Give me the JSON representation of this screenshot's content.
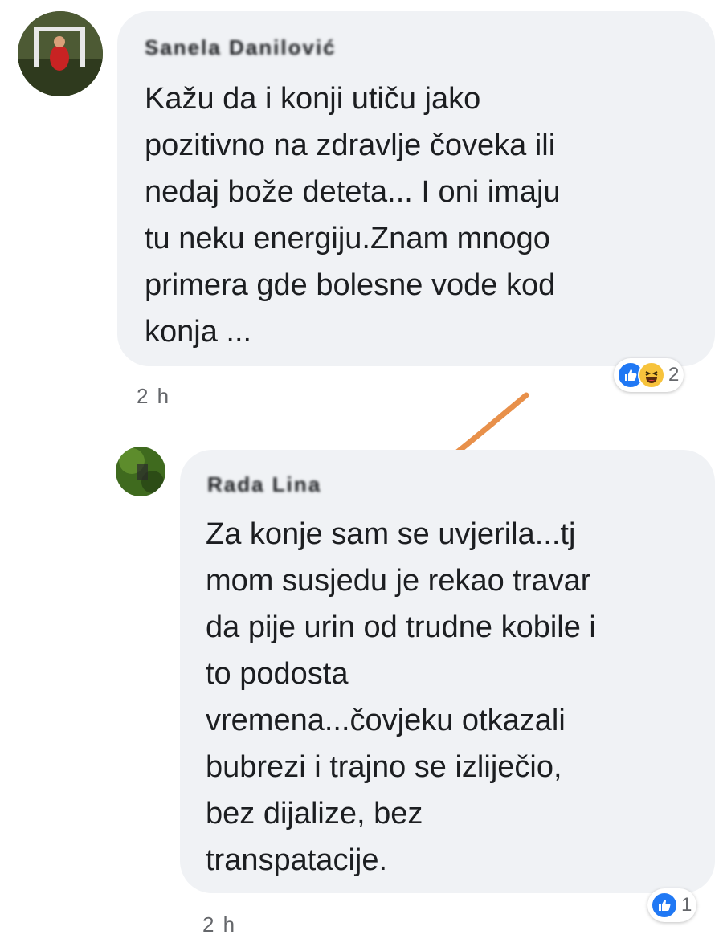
{
  "comments": [
    {
      "author": "Sanela Danilović",
      "text": "Kažu da i konji utiču jako\npozitivno na zdravlje čoveka ili\nnedaj bože deteta... I oni imaju\ntu neku energiju.Znam mnogo\nprimera gde bolesne vode kod\nkonja ...",
      "time": "2 h",
      "reaction_count": "2",
      "reactions": [
        "like-icon",
        "haha-icon"
      ]
    },
    {
      "author": "Rada Lina",
      "text": "Za konje sam se uvjerila...tj\nmom susjedu je rekao travar\nda pije urin od trudne kobile i\nto podosta\nvremena...čovjeku otkazali\nbubrezi i trajno se izliječio,\nbez dijalize, bez\ntranspatacije.",
      "time": "2 h",
      "reaction_count": "1",
      "reactions": [
        "like-icon"
      ]
    }
  ],
  "colors": {
    "bubble": "#f0f2f5",
    "like": "#2078f4",
    "haha": "#f7c33c",
    "checkmark": "#e8904a",
    "muted": "#65676b"
  }
}
